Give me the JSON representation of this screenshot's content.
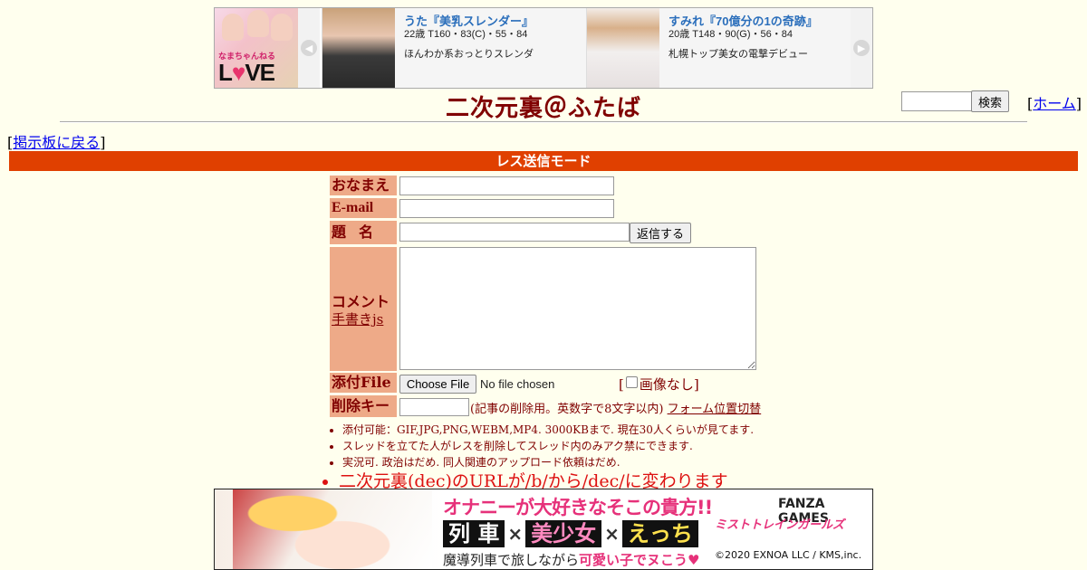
{
  "top_ad": {
    "main_caption": "なまちゃんねる",
    "main_logo_pre": "L",
    "main_logo_heart": "♥",
    "main_logo_post": "VE",
    "cards": [
      {
        "name": "うた『美乳スレンダー』",
        "stats": "22歳 T160・83(C)・55・84",
        "desc": "ほんわか系おっとりスレンダ"
      },
      {
        "name": "すみれ『70億分の1の奇跡』",
        "stats": "20歳 T148・90(G)・56・84",
        "desc": "札幌トップ美女の電撃デビュー"
      }
    ],
    "prev_arrow": "◀",
    "next_arrow": "▶"
  },
  "header": {
    "title": "二次元裏＠ふたば",
    "search_button": "検索",
    "home_prefix": "[",
    "home_link": "ホーム",
    "home_suffix": "]"
  },
  "back": {
    "prefix": "[",
    "link": "掲示板に戻る",
    "suffix": "]"
  },
  "mode_bar": "レス送信モード",
  "form": {
    "labels": {
      "name": "おなまえ",
      "email": "E-mail",
      "subject": "題名",
      "comment": "コメント",
      "handwriting": "手書きjs",
      "file": "添付File",
      "delkey": "削除キー"
    },
    "name_value": "",
    "email_value": "",
    "subject_value": "",
    "comment_value": "",
    "reply_button": "返信する",
    "file_button": "Choose File",
    "file_status": "No file chosen",
    "noimg_prefix": "[",
    "noimg_label": "画像なし",
    "noimg_suffix": "]",
    "delkey_value": "",
    "delkey_note": "(記事の削除用。英数字で8文字以内)",
    "form_toggle": "フォーム位置切替"
  },
  "notes": [
    "添付可能：GIF,JPG,PNG,WEBM,MP4. 3000KBまで. 現在30人くらいが見てます.",
    "スレッドを立てた人がレスを削除してスレッド内のみアク禁にできます.",
    "実況可. 政治はだめ. 同人関連のアップロード依頼はだめ.",
    "二次元裏(dec)のURLが/b/から/dec/に変わります"
  ],
  "bottom_ad": {
    "headline": "オナニーが大好きなそこの貴方!!",
    "boxes": [
      "列 車",
      "美少女",
      "えっち"
    ],
    "times": "×",
    "sub_pre": "魔導列車で旅しながら",
    "sub_em": "可愛い子でヌこう♥",
    "brand": "FANZA GAMES",
    "game_title": "ミストトレインガールズ",
    "copyright": "©2020 EXNOA LLC / KMS,inc."
  }
}
